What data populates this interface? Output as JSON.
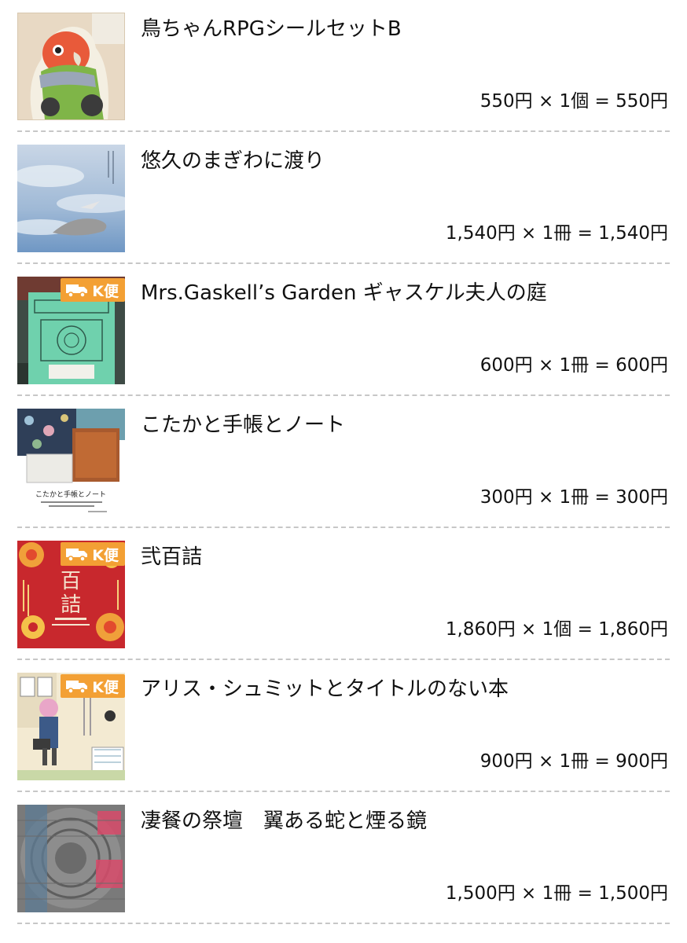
{
  "badge_label": "K便",
  "items": [
    {
      "title": "鳥ちゃんRPGシールセットB",
      "price_line": "550円 × 1個 = 550円",
      "thumbnail": "parrot-sticker-thumbnail",
      "has_badge": false
    },
    {
      "title": "悠久のまぎわに渡り",
      "price_line": "1,540円 × 1冊 = 1,540円",
      "thumbnail": "sky-cover-thumbnail",
      "has_badge": false
    },
    {
      "title": "Mrs.Gaskell’s Garden ギャスケル夫人の庭",
      "price_line": "600円 × 1冊 = 600円",
      "thumbnail": "green-book-thumbnail",
      "has_badge": true
    },
    {
      "title": "こたかと手帳とノート",
      "price_line": "300円 × 1冊 = 300円",
      "thumbnail": "notebook-collage-thumbnail",
      "has_badge": false
    },
    {
      "title": "弐百詰",
      "price_line": "1,860円 × 1個 = 1,860円",
      "thumbnail": "red-floral-cover-thumbnail",
      "has_badge": true
    },
    {
      "title": "アリス・シュミットとタイトルのない本",
      "price_line": "900円 × 1冊 = 900円",
      "thumbnail": "illustrated-girl-cover-thumbnail",
      "has_badge": true
    },
    {
      "title": "凄餐の祭壇　翼ある蛇と煙る鏡",
      "price_line": "1,500円 × 1冊 = 1,500円",
      "thumbnail": "aztec-stone-cover-thumbnail",
      "has_badge": false
    }
  ],
  "colors": {
    "badge_background": "#f3a034",
    "divider": "#c7c7c7",
    "text": "#111111"
  }
}
